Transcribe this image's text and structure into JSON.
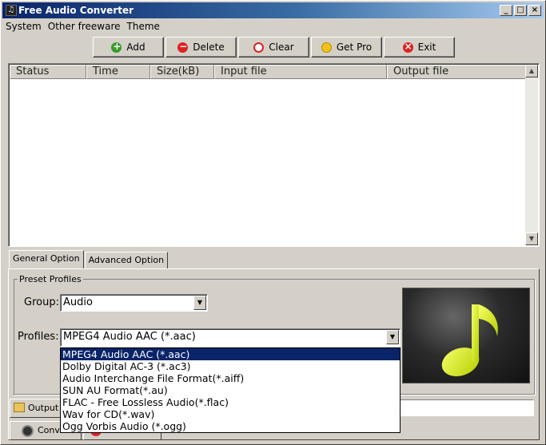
{
  "window": {
    "title": "Free Audio Converter",
    "minimize": "_",
    "maximize": "□",
    "close": "×"
  },
  "menu": [
    {
      "label": "System"
    },
    {
      "label": "Other freeware"
    },
    {
      "label": "Theme"
    }
  ],
  "toolbar": {
    "add": "Add",
    "delete": "Delete",
    "clear": "Clear",
    "get_pro": "Get Pro",
    "exit": "Exit"
  },
  "list": {
    "columns": [
      "Status",
      "Time",
      "Size(kB)",
      "Input file",
      "Output file"
    ],
    "rows": []
  },
  "tabs": [
    {
      "label": "General Option",
      "active": true
    },
    {
      "label": "Advanced Option",
      "active": false
    }
  ],
  "preset": {
    "legend": "Preset Profiles",
    "group_label": "Group:",
    "group_value": "Audio",
    "profiles_label": "Profiles:",
    "profiles_value": "MPEG4 Audio AAC (*.aac)",
    "options": [
      "MPEG4 Audio AAC (*.aac)",
      "Dolby Digital AC-3 (*.ac3)",
      "Audio Interchange File Format(*.aiff)",
      "SUN AU Format(*.au)",
      "FLAC - Free Lossless Audio(*.flac)",
      "Wav for CD(*.wav)",
      "Ogg Vorbis Audio (*.ogg)"
    ],
    "selected_index": 0
  },
  "output": {
    "dir_button": "Output D",
    "dir_value": ""
  },
  "convert": {
    "label": "Conve"
  },
  "colors": {
    "accent": "#0a246a",
    "note": "#d8f021"
  }
}
